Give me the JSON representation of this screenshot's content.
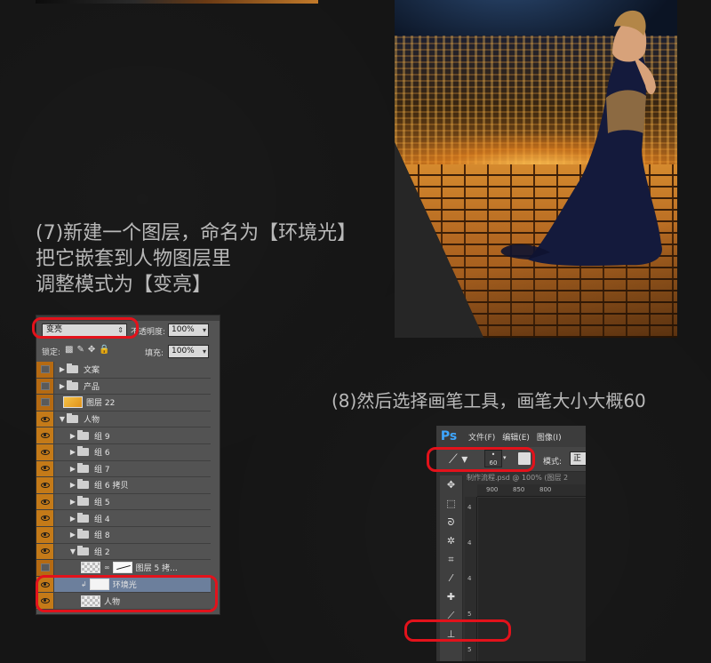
{
  "step7": {
    "line1": "(7)新建一个图层，命名为【环境光】",
    "line2": "把它嵌套到人物图层里",
    "line3": "调整模式为【变亮】"
  },
  "step8": {
    "text": "(8)然后选择画笔工具，画笔大小大概60"
  },
  "layers_panel": {
    "blend_mode": "变亮",
    "opacity_label": "不透明度:",
    "opacity_value": "100%",
    "lock_label": "锁定:",
    "fill_label": "填充:",
    "fill_value": "100%",
    "layers": [
      {
        "name": "文案",
        "type": "group",
        "visible": false,
        "expanded": false
      },
      {
        "name": "产品",
        "type": "group",
        "visible": false,
        "expanded": false
      },
      {
        "name": "图层 22",
        "type": "layer",
        "visible": false
      },
      {
        "name": "人物",
        "type": "group",
        "visible": true,
        "expanded": true
      },
      {
        "name": "组 9",
        "type": "group",
        "visible": true,
        "expanded": false
      },
      {
        "name": "组 6",
        "type": "group",
        "visible": true,
        "expanded": false
      },
      {
        "name": "组 7",
        "type": "group",
        "visible": true,
        "expanded": false
      },
      {
        "name": "组 6 拷贝",
        "type": "group",
        "visible": true,
        "expanded": false
      },
      {
        "name": "组 5",
        "type": "group",
        "visible": true,
        "expanded": false
      },
      {
        "name": "组 4",
        "type": "group",
        "visible": true,
        "expanded": false
      },
      {
        "name": "组 8",
        "type": "group",
        "visible": true,
        "expanded": false
      },
      {
        "name": "组 2",
        "type": "group",
        "visible": true,
        "expanded": true
      },
      {
        "name": "图层 5 拷...",
        "type": "masked-layer",
        "visible": false
      },
      {
        "name": "环境光",
        "type": "clipped-layer",
        "visible": true,
        "selected": true
      },
      {
        "name": "人物",
        "type": "smart-layer",
        "visible": true
      }
    ]
  },
  "photoshop": {
    "logo": "Ps",
    "menu": [
      "文件(F)",
      "编辑(E)",
      "图像(I)"
    ],
    "brush_size": "60",
    "mode_label": "模式:",
    "mode_value": "正",
    "doc_tab": "制作流程.psd @ 100% (图层 2",
    "ruler_top": [
      "900",
      "850",
      "800"
    ],
    "ruler_left": [
      "4",
      "4",
      "4",
      "5",
      "5"
    ]
  },
  "colors": {
    "highlight": "#e3121b",
    "eye_column": "#c47a18",
    "selected_row": "#6c7f9c",
    "ps_blue": "#3ea6ff"
  }
}
